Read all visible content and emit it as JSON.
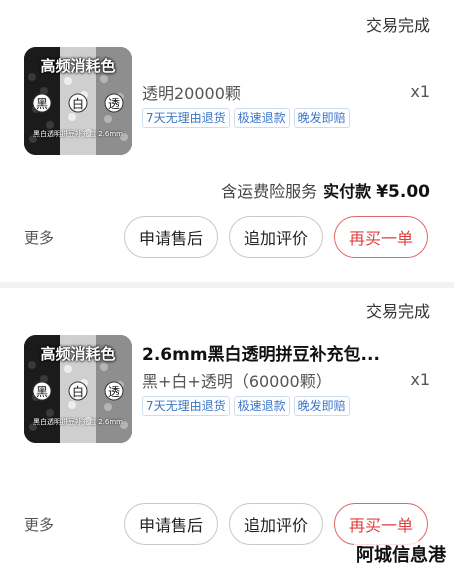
{
  "orders": [
    {
      "status": "交易完成",
      "thumbnail": {
        "title": "高频消耗色",
        "labels": [
          "黑",
          "白",
          "透"
        ],
        "subtext": "黑白透明拼豆补充包 2.6mm"
      },
      "title": "",
      "spec": "透明20000颗",
      "qty": "x1",
      "tags": [
        "7天无理由退货",
        "极速退款",
        "晚发即赔"
      ],
      "insurance": "含运费险服务",
      "paid_label": "实付款",
      "paid_amount": "¥5.00",
      "more": "更多",
      "buttons": {
        "after_sale": "申请售后",
        "add_review": "追加评价",
        "buy_again": "再买一单"
      }
    },
    {
      "status": "交易完成",
      "thumbnail": {
        "title": "高频消耗色",
        "labels": [
          "黑",
          "白",
          "透"
        ],
        "subtext": "黑白透明拼豆补充包 2.6mm"
      },
      "title": "2.6mm黑白透明拼豆补充包...",
      "spec": "黑+白+透明（60000颗）",
      "qty": "x1",
      "tags": [
        "7天无理由退货",
        "极速退款",
        "晚发即赔"
      ],
      "more": "更多",
      "buttons": {
        "after_sale": "申请售后",
        "add_review": "追加评价",
        "buy_again": "再买一单"
      }
    }
  ],
  "watermark": "阿城信息港",
  "colors": {
    "accent_red": "#e04040",
    "tag_blue": "#3a76c7"
  }
}
